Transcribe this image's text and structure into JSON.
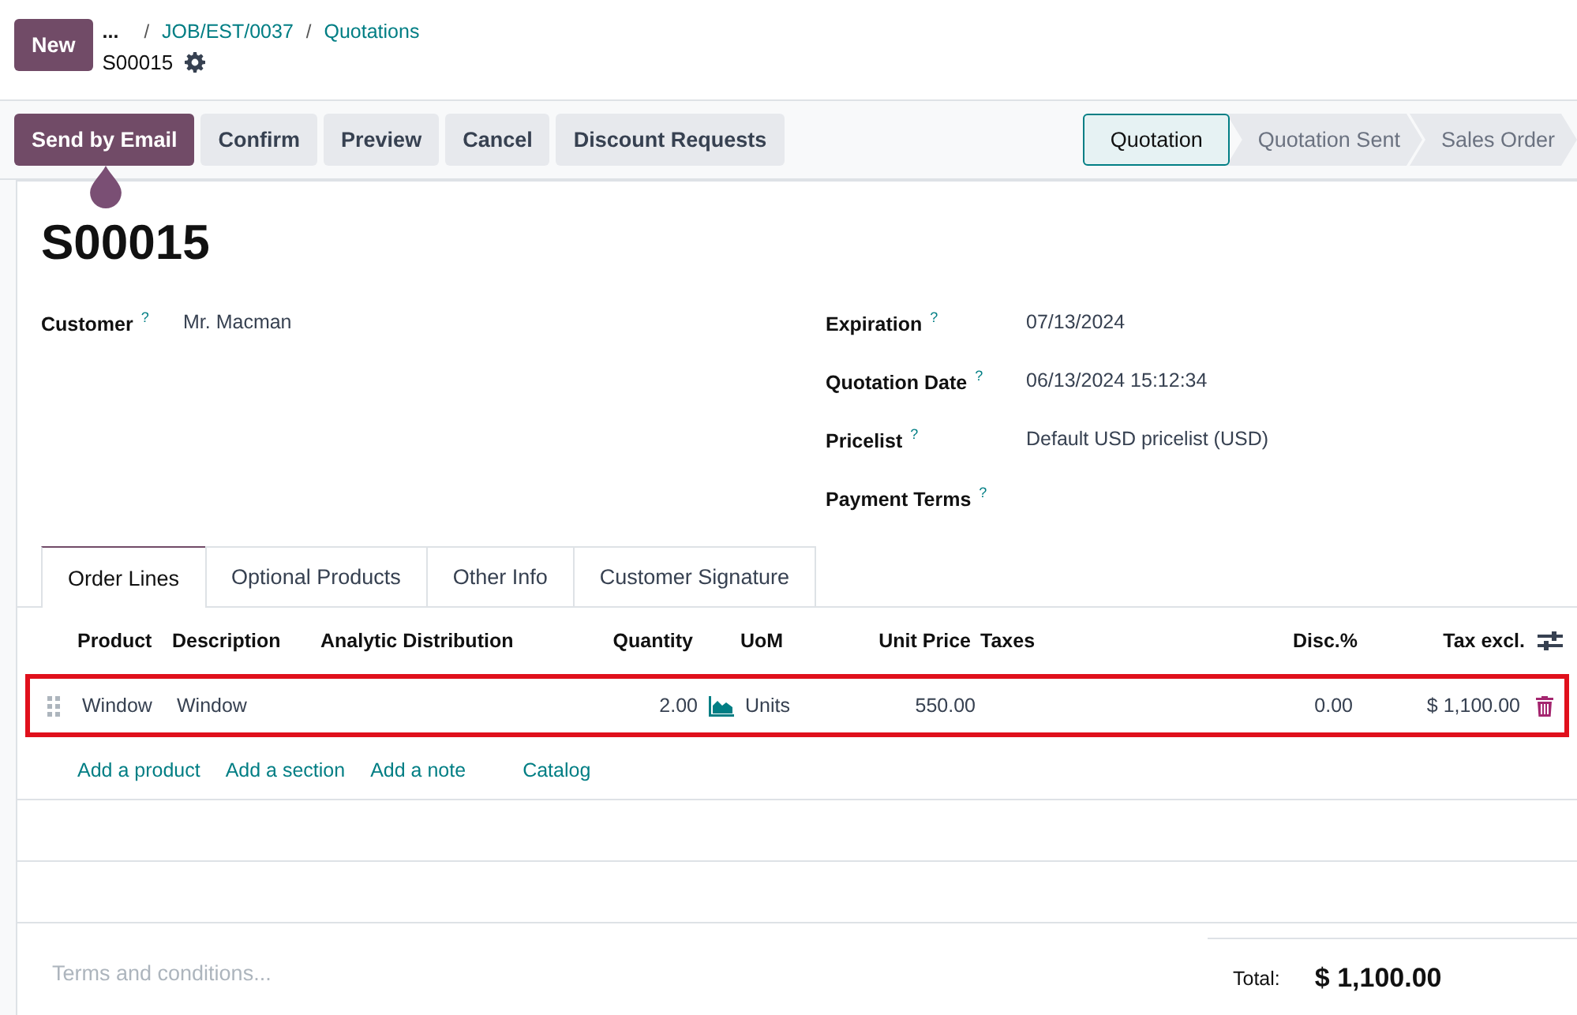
{
  "top_bar": {
    "new_button": "New",
    "breadcrumbs": [
      {
        "label": "..."
      },
      {
        "label": "JOB/EST/0037"
      },
      {
        "label": "Quotations"
      }
    ],
    "separator": "/",
    "record": "S00015"
  },
  "actions": [
    {
      "label": "Send by Email",
      "primary": true
    },
    {
      "label": "Confirm",
      "primary": false
    },
    {
      "label": "Preview",
      "primary": false
    },
    {
      "label": "Cancel",
      "primary": false
    },
    {
      "label": "Discount Requests",
      "primary": false
    }
  ],
  "stages": [
    {
      "label": "Quotation",
      "selected": true
    },
    {
      "label": "Quotation Sent",
      "selected": false
    },
    {
      "label": "Sales Order",
      "selected": false
    }
  ],
  "title": "S00015",
  "left_fields": [
    {
      "label": "Customer",
      "help": "?",
      "value": "Mr. Macman"
    }
  ],
  "right_fields": [
    {
      "label": "Expiration",
      "help": "?",
      "value": "07/13/2024"
    },
    {
      "label": "Quotation Date",
      "help": "?",
      "value": "06/13/2024 15:12:34"
    },
    {
      "label": "Pricelist",
      "help": "?",
      "value": "Default USD pricelist (USD)"
    },
    {
      "label": "Payment Terms",
      "help": "?"
    }
  ],
  "tabs": [
    {
      "label": "Order Lines",
      "selected": true
    },
    {
      "label": "Optional Products",
      "selected": false
    },
    {
      "label": "Other Info",
      "selected": false
    },
    {
      "label": "Customer Signature",
      "selected": false
    }
  ],
  "table": {
    "columns": [
      "Product",
      "Description",
      "Analytic Distribution",
      "Quantity",
      "UoM",
      "Unit Price",
      "Taxes",
      "Disc.%",
      "Tax excl."
    ],
    "rows": [
      {
        "highlighted": true,
        "product": "Window",
        "description": "Window",
        "quantity": "2.00",
        "uom": "Units",
        "unit_price": "550.00",
        "discount": "0.00",
        "subtotal": "$ 1,100.00"
      }
    ]
  },
  "add_links": [
    "Add a product",
    "Add a section",
    "Add a note",
    "Catalog"
  ],
  "terms": {
    "placeholder": "Terms and conditions..."
  },
  "total": {
    "label": "Total:",
    "value": "$ 1,100.00"
  }
}
